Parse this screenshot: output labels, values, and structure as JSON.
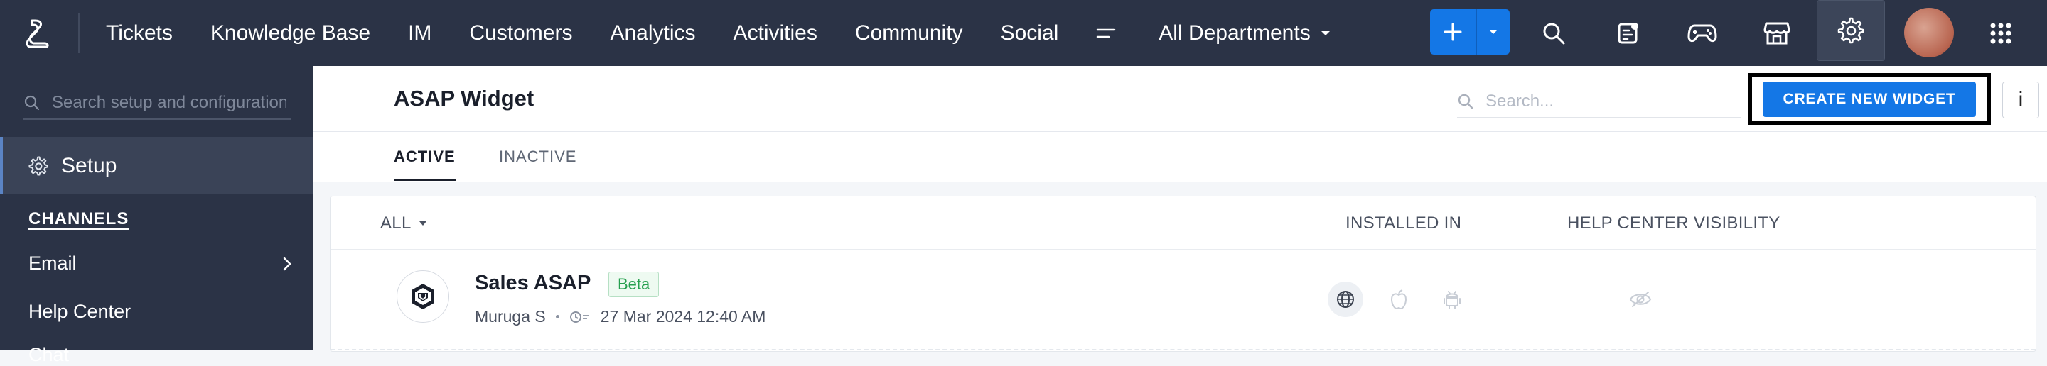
{
  "nav": {
    "items": [
      "Tickets",
      "Knowledge Base",
      "IM",
      "Customers",
      "Analytics",
      "Activities",
      "Community",
      "Social"
    ],
    "department": "All Departments"
  },
  "icons": {
    "logo": "desk-logo-icon",
    "menu": "menu-lines-icon",
    "add": "plus-icon",
    "add_dropdown": "chevron-down-icon",
    "search": "search-icon",
    "notes": "notes-icon",
    "games": "gamepad-icon",
    "marketplace": "store-icon",
    "settings": "gear-icon",
    "apps": "grid-icon",
    "platforms": [
      "globe-icon",
      "apple-icon",
      "android-icon"
    ],
    "visibility": "eye-off-icon"
  },
  "sidebar": {
    "search_placeholder": "Search setup and configuration",
    "setup_label": "Setup",
    "section": "CHANNELS",
    "items": [
      "Email",
      "Help Center",
      "Chat"
    ]
  },
  "page": {
    "title": "ASAP Widget",
    "search_placeholder": "Search...",
    "create_button": "CREATE NEW WIDGET",
    "info_label": "i"
  },
  "tabs": [
    "ACTIVE",
    "INACTIVE"
  ],
  "table": {
    "filter": "ALL",
    "columns": [
      "INSTALLED IN",
      "HELP CENTER VISIBILITY"
    ],
    "rows": [
      {
        "name": "Sales ASAP",
        "badge": "Beta",
        "owner": "Muruga S",
        "date": "27 Mar 2024 12:40 AM"
      }
    ]
  },
  "colors": {
    "topbar": "#2b3346",
    "accent": "#1477e6",
    "beta_green": "#27a04f"
  }
}
